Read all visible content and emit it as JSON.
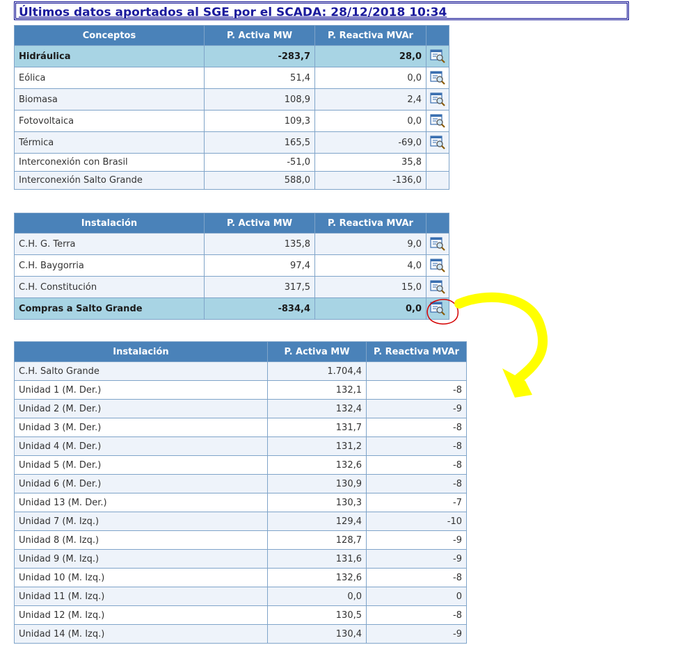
{
  "header": {
    "title": "Últimos datos aportados al SGE por el SCADA: 28/12/2018 10:34"
  },
  "table1": {
    "headers": [
      "Conceptos",
      "P. Activa MW",
      "P. Reactiva MVAr"
    ],
    "rows": [
      {
        "name": "Hidráulica",
        "activa": "-283,7",
        "reactiva": "28,0"
      },
      {
        "name": "Eólica",
        "activa": "51,4",
        "reactiva": "0,0"
      },
      {
        "name": "Biomasa",
        "activa": "108,9",
        "reactiva": "2,4"
      },
      {
        "name": "Fotovoltaica",
        "activa": "109,3",
        "reactiva": "0,0"
      },
      {
        "name": "Térmica",
        "activa": "165,5",
        "reactiva": "-69,0"
      },
      {
        "name": "Interconexión con Brasil",
        "activa": "-51,0",
        "reactiva": "35,8"
      },
      {
        "name": "Interconexión Salto Grande",
        "activa": "588,0",
        "reactiva": "-136,0"
      }
    ]
  },
  "table2": {
    "headers": [
      "Instalación",
      "P. Activa MW",
      "P. Reactiva MVAr"
    ],
    "rows": [
      {
        "name": "C.H. G. Terra",
        "activa": "135,8",
        "reactiva": "9,0"
      },
      {
        "name": "C.H. Baygorria",
        "activa": "97,4",
        "reactiva": "4,0"
      },
      {
        "name": "C.H. Constitución",
        "activa": "317,5",
        "reactiva": "15,0"
      },
      {
        "name": "Compras a Salto Grande",
        "activa": "-834,4",
        "reactiva": "0,0"
      }
    ]
  },
  "table3": {
    "headers": [
      "Instalación",
      "P. Activa MW",
      "P. Reactiva MVAr"
    ],
    "rows": [
      {
        "name": "C.H. Salto Grande",
        "activa": "1.704,4",
        "reactiva": ""
      },
      {
        "name": "Unidad 1 (M. Der.)",
        "activa": "132,1",
        "reactiva": "-8"
      },
      {
        "name": "Unidad 2 (M. Der.)",
        "activa": "132,4",
        "reactiva": "-9"
      },
      {
        "name": "Unidad 3 (M. Der.)",
        "activa": "131,7",
        "reactiva": "-8"
      },
      {
        "name": "Unidad 4 (M. Der.)",
        "activa": "131,2",
        "reactiva": "-8"
      },
      {
        "name": "Unidad 5 (M. Der.)",
        "activa": "132,6",
        "reactiva": "-8"
      },
      {
        "name": "Unidad 6 (M. Der.)",
        "activa": "130,9",
        "reactiva": "-8"
      },
      {
        "name": "Unidad 13 (M. Der.)",
        "activa": "130,3",
        "reactiva": "-7"
      },
      {
        "name": "Unidad 7 (M. Izq.)",
        "activa": "129,4",
        "reactiva": "-10"
      },
      {
        "name": "Unidad 8 (M. Izq.)",
        "activa": "128,7",
        "reactiva": "-9"
      },
      {
        "name": "Unidad 9 (M. Izq.)",
        "activa": "131,6",
        "reactiva": "-9"
      },
      {
        "name": "Unidad 10 (M. Izq.)",
        "activa": "132,6",
        "reactiva": "-8"
      },
      {
        "name": "Unidad 11 (M. Izq.)",
        "activa": "0,0",
        "reactiva": "0"
      },
      {
        "name": "Unidad 12 (M. Izq.)",
        "activa": "130,5",
        "reactiva": "-8"
      },
      {
        "name": "Unidad 14 (M. Izq.)",
        "activa": "130,4",
        "reactiva": "-9"
      }
    ]
  },
  "icons": {
    "detail": "zoom-detail-icon"
  },
  "colors": {
    "header_bg": "#4a82b9",
    "highlight_row": "#a8d4e4",
    "title": "#1a1a9c",
    "annotation_arrow": "#ffff00",
    "annotation_circle": "#d40000"
  }
}
